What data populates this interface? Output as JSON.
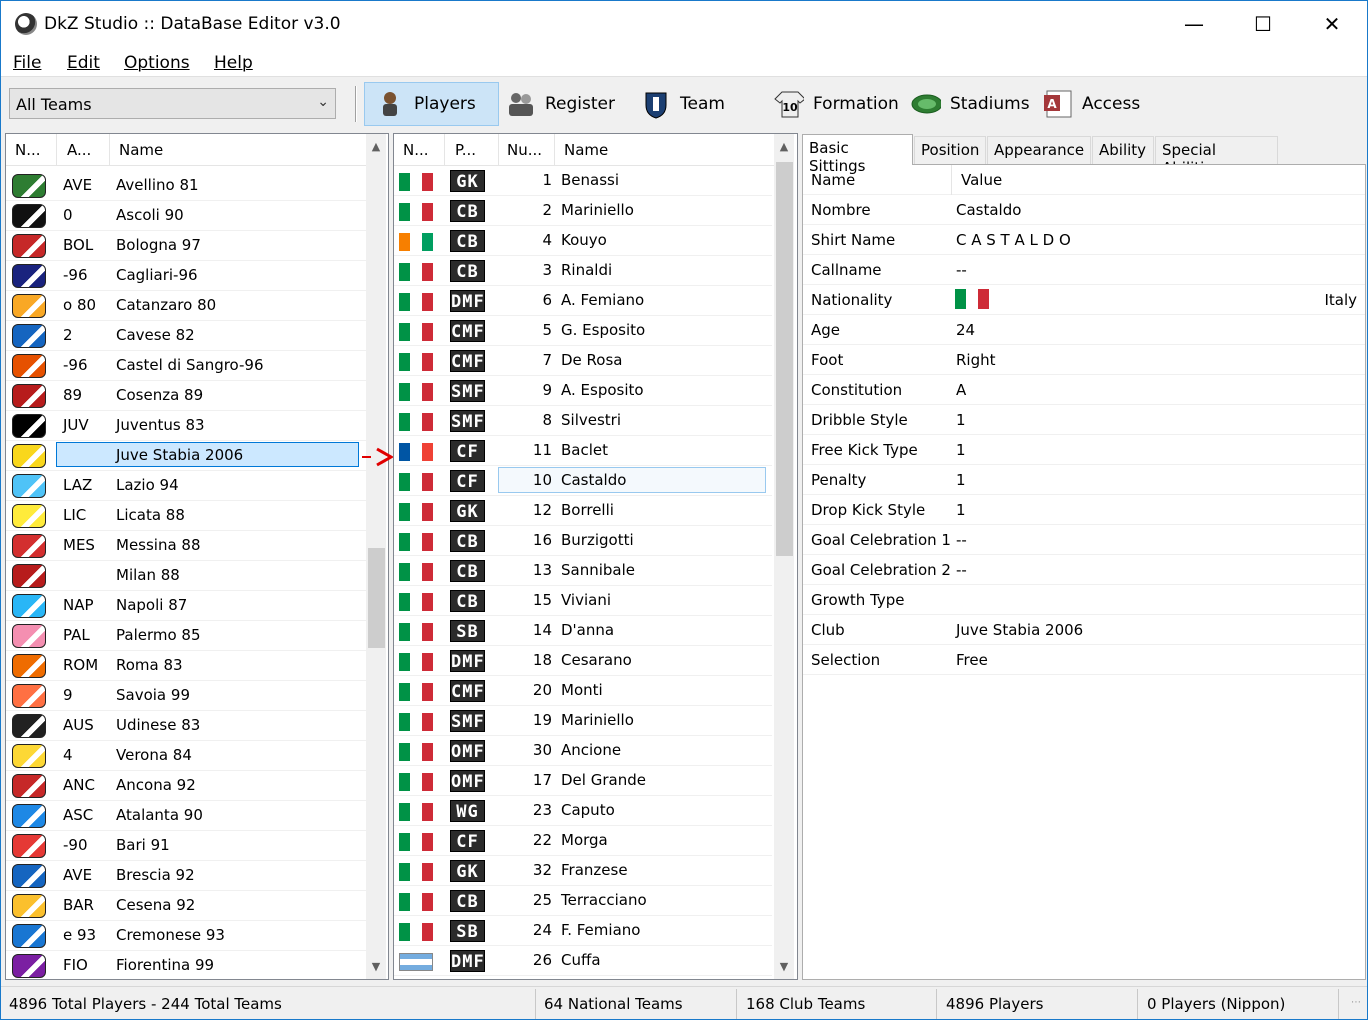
{
  "window": {
    "title": "DkZ Studio :: DataBase Editor v3.0"
  },
  "menu": [
    "File",
    "Edit",
    "Options",
    "Help"
  ],
  "toolbar": {
    "team_filter": "All Teams",
    "buttons": [
      {
        "label": "Players",
        "icon": "player-icon"
      },
      {
        "label": "Register",
        "icon": "register-icon"
      },
      {
        "label": "Team",
        "icon": "team-shield-icon"
      },
      {
        "label": "Formation",
        "icon": "formation-shirt-icon"
      },
      {
        "label": "Stadiums",
        "icon": "stadium-icon"
      },
      {
        "label": "Access",
        "icon": "access-icon"
      }
    ]
  },
  "teams": {
    "headers": [
      "N...",
      "A...",
      "Name"
    ],
    "rows": [
      {
        "abbr": "AVE",
        "name": "Avellino 81",
        "color": "#2e7d32"
      },
      {
        "abbr": "0",
        "name": "Ascoli 90",
        "color": "#111111"
      },
      {
        "abbr": "BOL",
        "name": "Bologna 97",
        "color": "#c62828"
      },
      {
        "abbr": "-96",
        "name": "Cagliari-96",
        "color": "#1a237e"
      },
      {
        "abbr": "o 80",
        "name": "Catanzaro 80",
        "color": "#f9a825"
      },
      {
        "abbr": "2",
        "name": "Cavese 82",
        "color": "#1565c0"
      },
      {
        "abbr": "-96",
        "name": "Castel di Sangro-96",
        "color": "#e65100"
      },
      {
        "abbr": "89",
        "name": "Cosenza 89",
        "color": "#b71c1c"
      },
      {
        "abbr": "JUV",
        "name": "Juventus 83",
        "color": "#000000"
      },
      {
        "abbr": "",
        "name": "Juve Stabia 2006",
        "color": "#f9d71c"
      },
      {
        "abbr": "LAZ",
        "name": "Lazio 94",
        "color": "#4fc3f7"
      },
      {
        "abbr": "LIC",
        "name": "Licata 88",
        "color": "#ffeb3b"
      },
      {
        "abbr": "MES",
        "name": "Messina 88",
        "color": "#d32f2f"
      },
      {
        "abbr": "",
        "name": "Milan 88",
        "color": "#b71c1c"
      },
      {
        "abbr": "NAP",
        "name": "Napoli 87",
        "color": "#29b6f6"
      },
      {
        "abbr": "PAL",
        "name": "Palermo 85",
        "color": "#f48fb1"
      },
      {
        "abbr": "ROM",
        "name": "Roma 83",
        "color": "#ef6c00"
      },
      {
        "abbr": "9",
        "name": "Savoia 99",
        "color": "#ff7043"
      },
      {
        "abbr": "AUS",
        "name": "Udinese 83",
        "color": "#212121"
      },
      {
        "abbr": "4",
        "name": "Verona 84",
        "color": "#fdd835"
      },
      {
        "abbr": "ANC",
        "name": "Ancona 92",
        "color": "#c62828"
      },
      {
        "abbr": "ASC",
        "name": "Atalanta 90",
        "color": "#1e88e5"
      },
      {
        "abbr": "-90",
        "name": "Bari 91",
        "color": "#e53935"
      },
      {
        "abbr": "AVE",
        "name": "Brescia 92",
        "color": "#1565c0"
      },
      {
        "abbr": "BAR",
        "name": "Cesena 92",
        "color": "#fbc02d"
      },
      {
        "abbr": "e 93",
        "name": "Cremonese 93",
        "color": "#1976d2"
      },
      {
        "abbr": "FIO",
        "name": "Fiorentina 99",
        "color": "#7b1fa2"
      }
    ],
    "selected_index": 9
  },
  "players": {
    "headers": [
      "N...",
      "P...",
      "Nu...",
      "Name"
    ],
    "rows": [
      {
        "flag": "it",
        "pos": "GK",
        "num": "1",
        "name": "Benassi"
      },
      {
        "flag": "it",
        "pos": "CB",
        "num": "2",
        "name": "Mariniello"
      },
      {
        "flag": "ci",
        "pos": "CB",
        "num": "4",
        "name": "Kouyo"
      },
      {
        "flag": "it",
        "pos": "CB",
        "num": "3",
        "name": "Rinaldi"
      },
      {
        "flag": "it",
        "pos": "DMF",
        "num": "6",
        "name": "A. Femiano"
      },
      {
        "flag": "it",
        "pos": "CMF",
        "num": "5",
        "name": "G. Esposito"
      },
      {
        "flag": "it",
        "pos": "CMF",
        "num": "7",
        "name": "De Rosa"
      },
      {
        "flag": "it",
        "pos": "SMF",
        "num": "9",
        "name": "A. Esposito"
      },
      {
        "flag": "it",
        "pos": "SMF",
        "num": "8",
        "name": "Silvestri"
      },
      {
        "flag": "fr",
        "pos": "CF",
        "num": "11",
        "name": "Baclet"
      },
      {
        "flag": "it",
        "pos": "CF",
        "num": "10",
        "name": "Castaldo"
      },
      {
        "flag": "it",
        "pos": "GK",
        "num": "12",
        "name": "Borrelli"
      },
      {
        "flag": "it",
        "pos": "CB",
        "num": "16",
        "name": "Burzigotti"
      },
      {
        "flag": "it",
        "pos": "CB",
        "num": "13",
        "name": "Sannibale"
      },
      {
        "flag": "it",
        "pos": "CB",
        "num": "15",
        "name": "Viviani"
      },
      {
        "flag": "it",
        "pos": "SB",
        "num": "14",
        "name": "D'anna"
      },
      {
        "flag": "it",
        "pos": "DMF",
        "num": "18",
        "name": "Cesarano"
      },
      {
        "flag": "it",
        "pos": "CMF",
        "num": "20",
        "name": "Monti"
      },
      {
        "flag": "it",
        "pos": "SMF",
        "num": "19",
        "name": "Mariniello"
      },
      {
        "flag": "it",
        "pos": "OMF",
        "num": "30",
        "name": "Ancione"
      },
      {
        "flag": "it",
        "pos": "OMF",
        "num": "17",
        "name": "Del Grande"
      },
      {
        "flag": "it",
        "pos": "WG",
        "num": "23",
        "name": "Caputo"
      },
      {
        "flag": "it",
        "pos": "CF",
        "num": "22",
        "name": "Morga"
      },
      {
        "flag": "it",
        "pos": "GK",
        "num": "32",
        "name": "Franzese"
      },
      {
        "flag": "it",
        "pos": "CB",
        "num": "25",
        "name": "Terracciano"
      },
      {
        "flag": "it",
        "pos": "SB",
        "num": "24",
        "name": "F. Femiano"
      },
      {
        "flag": "ar",
        "pos": "DMF",
        "num": "26",
        "name": "Cuffa"
      }
    ],
    "selected_index": 10
  },
  "details": {
    "tabs": [
      "Basic Sittings",
      "Position",
      "Appearance",
      "Ability",
      "Special Abilities"
    ],
    "active_tab": 0,
    "headers": [
      "Name",
      "Value"
    ],
    "props": [
      {
        "key": "Nombre",
        "value": "Castaldo"
      },
      {
        "key": "Shirt Name",
        "value": "C A S T A L D O"
      },
      {
        "key": "Callname",
        "value": "--"
      },
      {
        "key": "Nationality",
        "value": "Italy",
        "flag": "it"
      },
      {
        "key": "Age",
        "value": "24"
      },
      {
        "key": "Foot",
        "value": "Right"
      },
      {
        "key": "Constitution",
        "value": "A"
      },
      {
        "key": "Dribble Style",
        "value": "1"
      },
      {
        "key": "Free Kick Type",
        "value": "1"
      },
      {
        "key": "Penalty",
        "value": "1"
      },
      {
        "key": "Drop Kick Style",
        "value": "1"
      },
      {
        "key": "Goal Celebration 1",
        "value": "--"
      },
      {
        "key": "Goal Celebration 2",
        "value": "--"
      },
      {
        "key": "Growth Type",
        "value": ""
      },
      {
        "key": "Club",
        "value": "Juve Stabia 2006"
      },
      {
        "key": "Selection",
        "value": "Free"
      }
    ]
  },
  "status": {
    "totals": "4896 Total Players  -  244 Total Teams",
    "national": "64 National Teams",
    "club": "168 Club Teams",
    "players": "4896 Players",
    "nippon": "0 Players (Nippon)"
  },
  "colors": {
    "selection": "#cce8ff",
    "selection_border": "#0078d7",
    "arrow": "#e00000"
  }
}
